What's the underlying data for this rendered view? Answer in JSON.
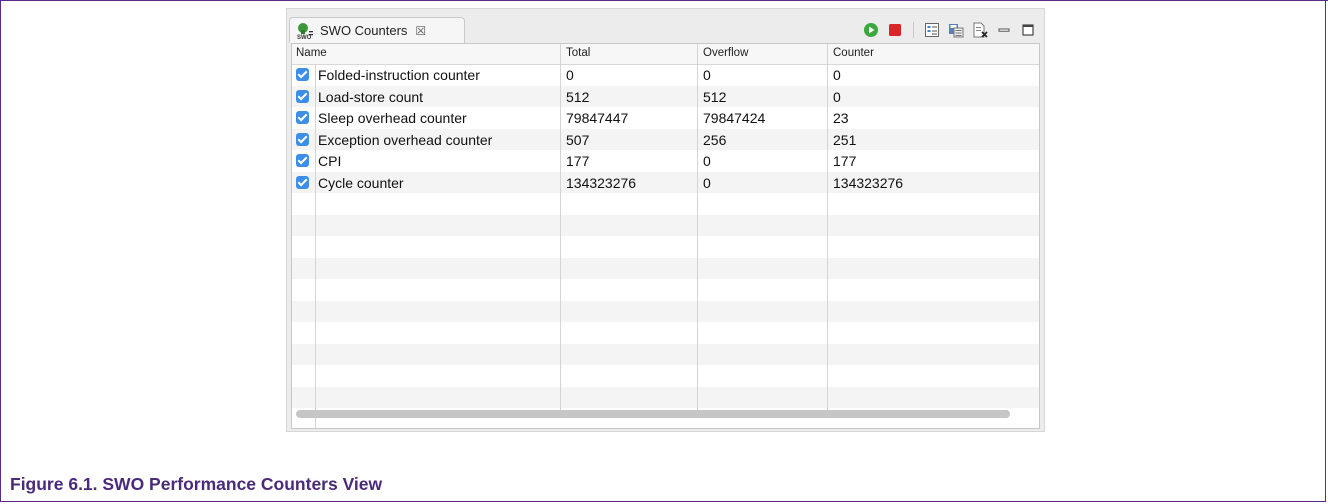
{
  "view": {
    "tab_title": "SWO Counters",
    "tab_close": "☒"
  },
  "columns": [
    "Name",
    "Total",
    "Overflow",
    "Counter"
  ],
  "rows": [
    {
      "name": "Folded-instruction counter",
      "total": "0",
      "overflow": "0",
      "counter": "0",
      "checked": true
    },
    {
      "name": "Load-store count",
      "total": "512",
      "overflow": "512",
      "counter": "0",
      "checked": true
    },
    {
      "name": "Sleep overhead counter",
      "total": "79847447",
      "overflow": "79847424",
      "counter": "23",
      "checked": true
    },
    {
      "name": "Exception overhead counter",
      "total": "507",
      "overflow": "256",
      "counter": "251",
      "checked": true
    },
    {
      "name": "CPI",
      "total": "177",
      "overflow": "0",
      "counter": "177",
      "checked": true
    },
    {
      "name": "Cycle counter",
      "total": "134323276",
      "overflow": "0",
      "counter": "134323276",
      "checked": true
    }
  ],
  "icons": {
    "start": "start-icon",
    "stop": "stop-icon",
    "configure": "configure-icon",
    "save": "save-icon",
    "clear": "clear-icon",
    "minimize": "minimize-icon",
    "maximize": "maximize-icon"
  },
  "colors": {
    "accent": "#5b2a86",
    "checkbox": "#3d8ee8",
    "start_green": "#3aa83a",
    "stop_red": "#d9262b"
  },
  "caption": "Figure 6.1. SWO Performance Counters View"
}
